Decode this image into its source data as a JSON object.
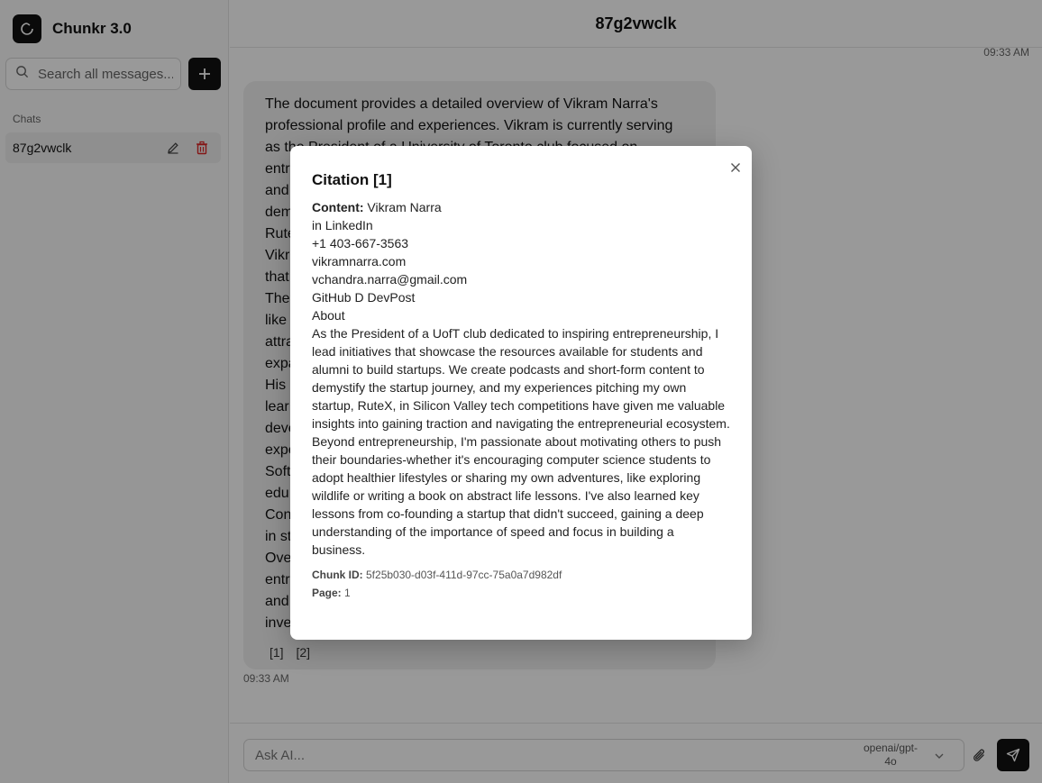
{
  "sidebar": {
    "brand": "Chunkr 3.0",
    "search_placeholder": "Search all messages...",
    "section_label": "Chats",
    "chats": [
      {
        "title": "87g2vwclk"
      }
    ]
  },
  "header": {
    "title": "87g2vwclk"
  },
  "conversation": {
    "timestamp_top": "09:33 AM",
    "message_lines": [
      "The document provides a detailed overview of Vikram Narra's",
      "professional profile and experiences. Vikram is currently serving",
      "as the President of a University of Toronto club focused on",
      "entr",
      "and",
      "dem",
      "Rute",
      "Vikr",
      "that",
      "The",
      "like",
      "attra",
      "expa",
      "His",
      "lear",
      "deve",
      "expe",
      "Soft",
      "edu",
      "Con",
      "in st",
      "Ove",
      "entr",
      "and",
      "inve"
    ],
    "citations": [
      "[1]",
      "[2]"
    ],
    "timestamp_bottom": "09:33 AM"
  },
  "composer": {
    "placeholder": "Ask AI...",
    "model_line1": "openai/gpt-",
    "model_line2": "4o"
  },
  "modal": {
    "title": "Citation [1]",
    "content_label": "Content:",
    "content_text": " Vikram Narra\nin LinkedIn\n+1 403-667-3563\nvikramnarra.com\nvchandra.narra@gmail.com\nGitHub D DevPost\nAbout\nAs the President of a UofT club dedicated to inspiring entrepreneurship, I lead initiatives that showcase the resources available for students and alumni to build startups. We create podcasts and short-form content to demystify the startup journey, and my experiences pitching my own startup, RuteX, in Silicon Valley tech competitions have given me valuable insights into gaining traction and navigating the entrepreneurial ecosystem.\nBeyond entrepreneurship, I'm passionate about motivating others to push their boundaries-whether it's encouraging computer science students to adopt healthier lifestyles or sharing my own adventures, like exploring wildlife or writing a book on abstract life lessons. I've also learned key lessons from co-founding a startup that didn't succeed, gaining a deep understanding of the importance of speed and focus in building a business.",
    "chunk_label": "Chunk ID:",
    "chunk_id": " 5f25b030-d03f-411d-97cc-75a0a7d982df",
    "page_label": "Page:",
    "page_value": " 1"
  },
  "colors": {
    "accent": "#111111",
    "danger": "#dc2626",
    "overlay": "rgba(0,0,0,0.40)"
  },
  "icons": [
    "logo-icon",
    "search-icon",
    "plus-icon",
    "pencil-icon",
    "trash-icon",
    "close-icon",
    "chevron-down-icon",
    "paperclip-icon",
    "send-icon"
  ]
}
